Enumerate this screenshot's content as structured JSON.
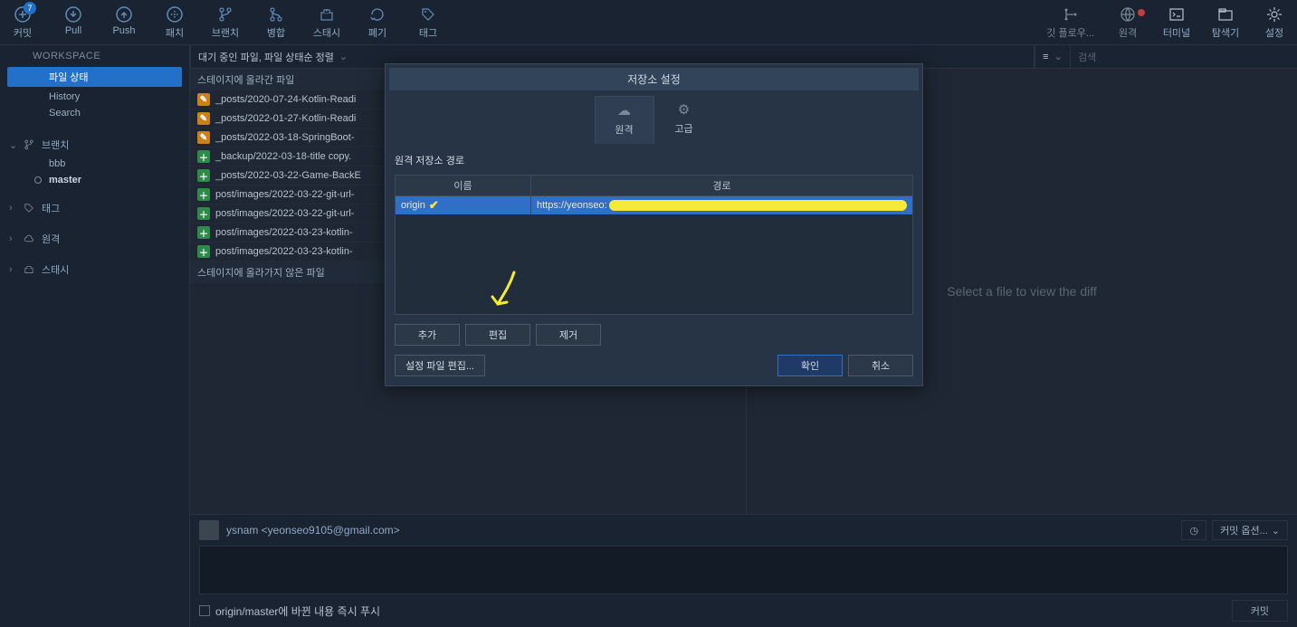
{
  "toolbar": {
    "commit": "커밋",
    "commit_count": "7",
    "pull": "Pull",
    "push": "Push",
    "patch": "패치",
    "branch": "브랜치",
    "merge": "병합",
    "stash": "스태시",
    "discard": "폐기",
    "tag": "태그",
    "gitflow": "깃 플로우...",
    "remote": "원격",
    "terminal": "터미널",
    "explorer": "탐색기",
    "settings": "설정"
  },
  "filterbar": {
    "pending": "대기 중인 파일, 파일 상태순 정렬",
    "view": "≡",
    "search_placeholder": "검색"
  },
  "sidebar": {
    "workspace": "WORKSPACE",
    "items": {
      "status": "파일 상태",
      "history": "History",
      "search": "Search"
    },
    "branch": "브랜치",
    "branches": {
      "b0": "bbb",
      "b1": "master"
    },
    "tag": "태그",
    "remote": "원격",
    "stash": "스태시"
  },
  "files": {
    "staged_label": "스테이지에 올라간 파일",
    "unstaged_label": "스테이지에 올라가지 않은 파일",
    "staged": [
      {
        "s": "mod",
        "p": "_posts/2020-07-24-Kotlin-Readi"
      },
      {
        "s": "mod",
        "p": "_posts/2022-01-27-Kotlin-Readi"
      },
      {
        "s": "mod",
        "p": "_posts/2022-03-18-SpringBoot-"
      },
      {
        "s": "add",
        "p": "_backup/2022-03-18-title copy."
      },
      {
        "s": "add",
        "p": "_posts/2022-03-22-Game-BackE"
      },
      {
        "s": "add",
        "p": "post/images/2022-03-22-git-url-"
      },
      {
        "s": "add",
        "p": "post/images/2022-03-22-git-url-"
      },
      {
        "s": "add",
        "p": "post/images/2022-03-23-kotlin-"
      },
      {
        "s": "add",
        "p": "post/images/2022-03-23-kotlin-"
      }
    ]
  },
  "diff": {
    "placeholder": "Select a file to view the diff"
  },
  "commit": {
    "author": "ysnam <yeonseo9105@gmail.com>",
    "options": "커밋 옵션...",
    "push_check": "origin/master에 바뀐 내용 즉시 푸시",
    "btn": "커밋"
  },
  "modal": {
    "title": "저장소 설정",
    "tabs": {
      "remote": "원격",
      "advanced": "고급"
    },
    "section": "원격 저장소 경로",
    "col_name": "이름",
    "col_path": "경로",
    "origin": "origin",
    "url_prefix": "https://yeonseo:",
    "btn_add": "추가",
    "btn_edit": "편집",
    "btn_remove": "제거",
    "btn_editfile": "설정 파일 편집...",
    "btn_ok": "확인",
    "btn_cancel": "취소"
  }
}
